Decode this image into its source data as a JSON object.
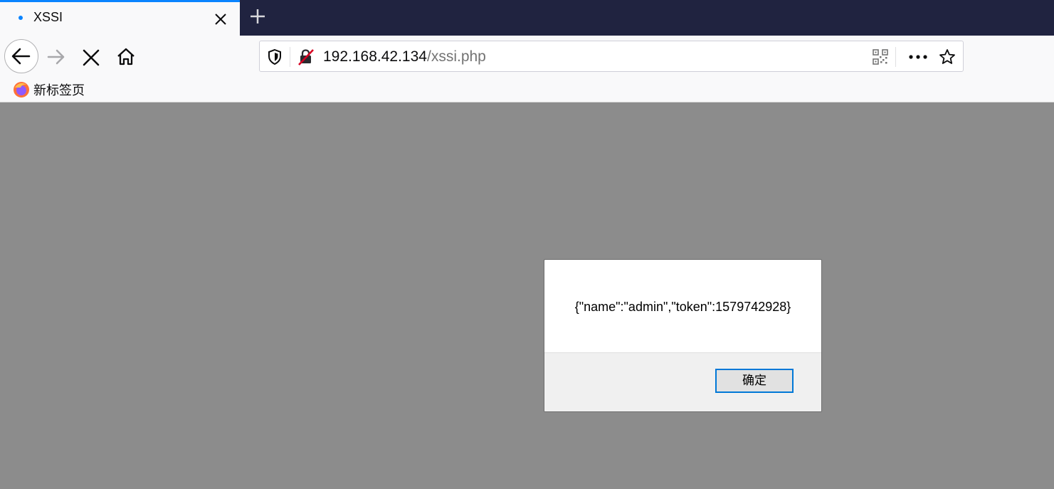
{
  "tab": {
    "title": "XSSI"
  },
  "url": {
    "host": "192.168.42.134",
    "path": "/xssi.php"
  },
  "bookmarks": [
    {
      "label": "新标签页"
    }
  ],
  "dialog": {
    "message": "{\"name\":\"admin\",\"token\":1579742928}",
    "ok_label": "确定"
  },
  "colors": {
    "tab_strip": "#202340",
    "accent": "#0a84ff",
    "page_overlay": "#8c8c8c",
    "insecure_icon": "#d70022"
  }
}
